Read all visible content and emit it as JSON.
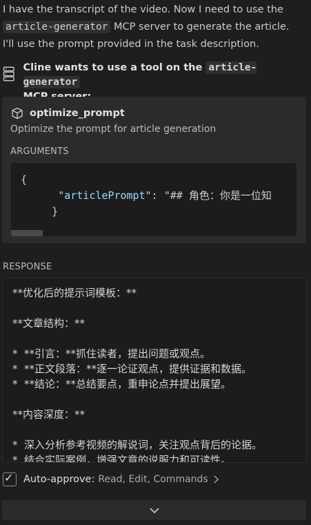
{
  "intro": {
    "line1": "I have the transcript of the video. Now I need to use the",
    "server_chip": "article-generator",
    "line2_rest": " MCP server to generate the article.",
    "line3": "I'll use the prompt provided in the task description."
  },
  "tool_request": {
    "prefix": "Cline wants to use a tool on the ",
    "server": "article-generator",
    "suffix": "MCP server:"
  },
  "tool": {
    "name": "optimize_prompt",
    "description": "Optimize the prompt for article generation",
    "arguments_label": "ARGUMENTS",
    "args_open": "{",
    "arg_key": "\"articlePrompt\"",
    "arg_sep": ": ",
    "arg_value": "\"## 角色：你是一位知",
    "args_close": "}"
  },
  "response": {
    "label": "RESPONSE",
    "text": "**优化后的提示词模板：**\n\n**文章结构：**\n\n*  **引言：**抓住读者，提出问题或观点。\n*  **正文段落：**逐一论证观点，提供证据和数据。\n*  **结论：**总结要点，重申论点并提出展望。\n\n**内容深度：**\n\n*  深入分析参考视频的解说词，关注观点背后的论据。\n*  结合实际案例，增强文章的说服力和可读性。"
  },
  "auto_approve": {
    "checked": true,
    "label": "Auto-approve:",
    "items": "Read, Edit, Commands"
  },
  "icons": {
    "server": "server-icon",
    "tool": "cube-icon",
    "check": "check-icon",
    "chevron_right": "chevron-right-icon",
    "chevron_down": "chevron-down-icon"
  }
}
